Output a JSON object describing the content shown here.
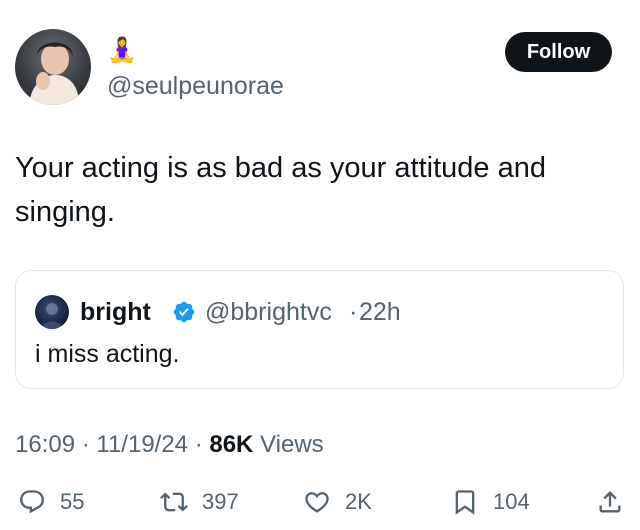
{
  "author": {
    "display_name": "🧘‍♀️",
    "handle": "@seulpeunorae",
    "avatar_icon": "profile-photo"
  },
  "follow_label": "Follow",
  "tweet_text": "Your acting is as bad as your attitude and singing.",
  "quote": {
    "name": "bright",
    "handle": "@bbrightvc",
    "separator": "·",
    "time": "22h",
    "text": "i miss acting.",
    "verified": true
  },
  "meta": {
    "time": "16:09",
    "sep1": " · ",
    "date": "11/19/24",
    "sep2": " · ",
    "views_count": "86K",
    "views_label": " Views"
  },
  "actions": {
    "replies": "55",
    "reposts": "397",
    "likes": "2K",
    "bookmarks": "104"
  },
  "colors": {
    "text": "#0f1419",
    "secondary": "#536471",
    "border": "#e1e8ed",
    "verified": "#1d9bf0",
    "follow_bg": "#0f1419"
  }
}
